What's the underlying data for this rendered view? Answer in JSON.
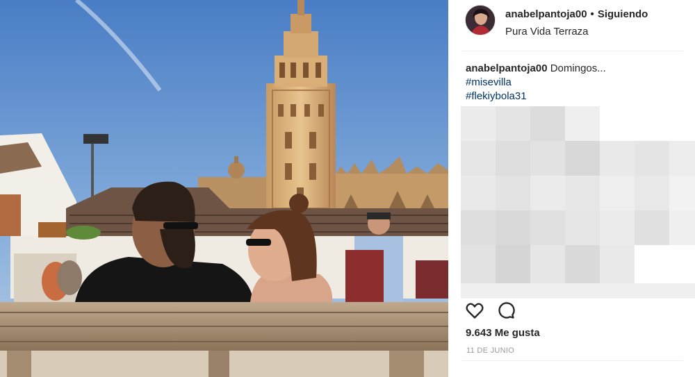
{
  "post": {
    "username": "anabelpantoja00",
    "separator": "•",
    "follow_status": "Siguiendo",
    "location": "Pura Vida Terraza",
    "caption_user": "anabelpantoja00",
    "caption_text": "Domingos...",
    "hashtags": [
      "#misevilla",
      "#flekiybola31"
    ],
    "likes": "9.643 Me gusta",
    "date": "11 DE JUNIO"
  },
  "icons": {
    "like": "heart-icon",
    "comment": "comment-icon"
  },
  "colors": {
    "text": "#262626",
    "hashtag": "#003569",
    "muted": "#999999",
    "divider": "#efefef",
    "sky": "#4d7fc4"
  }
}
